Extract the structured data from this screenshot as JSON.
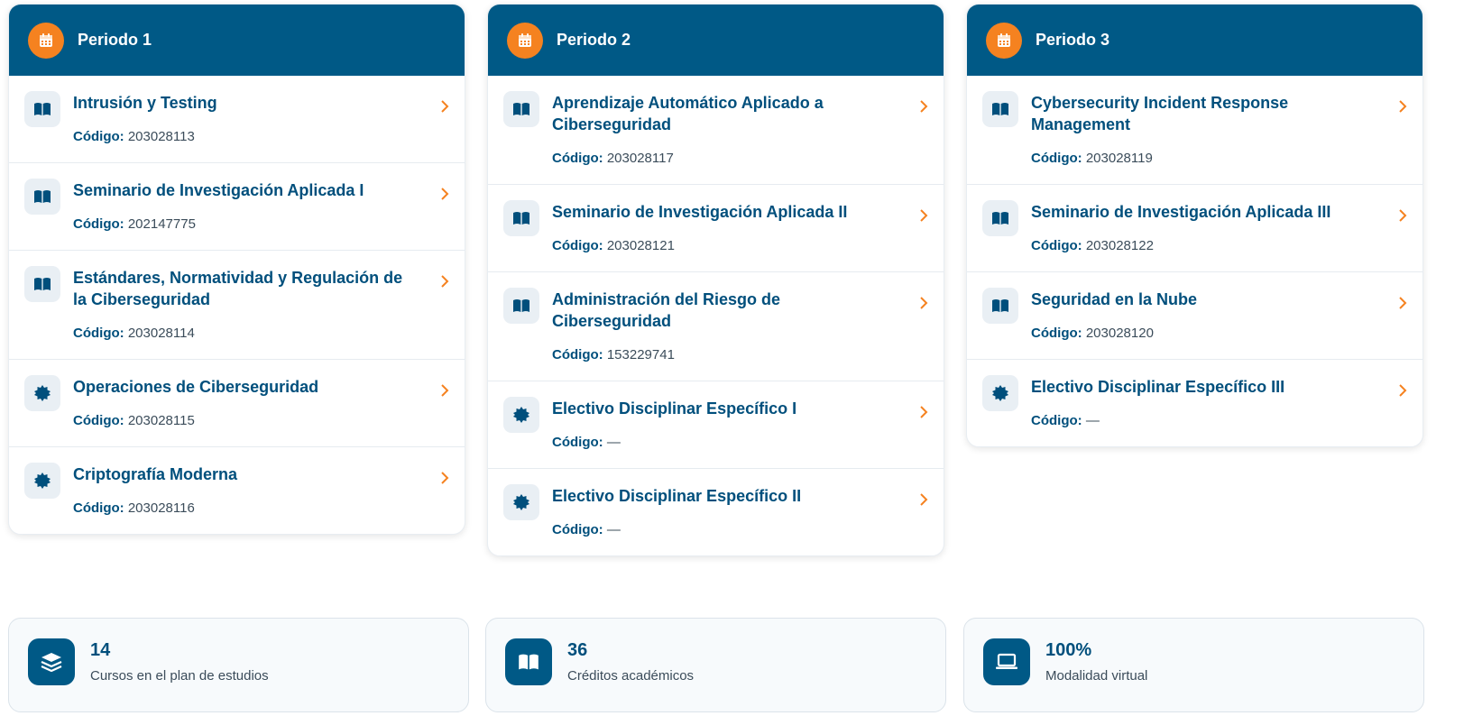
{
  "code_label": "Código:",
  "periods": [
    {
      "title": "Periodo 1",
      "courses": [
        {
          "name": "Intrusión y Testing",
          "code": "203028113",
          "icon": "book-icon"
        },
        {
          "name": "Seminario de Investigación Aplicada I",
          "code": "202147775",
          "icon": "book-icon"
        },
        {
          "name": "Estándares, Normatividad y Regulación de la Ciberseguridad",
          "code": "203028114",
          "icon": "book-icon"
        },
        {
          "name": "Operaciones de Ciberseguridad",
          "code": "203028115",
          "icon": "badge-icon"
        },
        {
          "name": "Criptografía Moderna",
          "code": "203028116",
          "icon": "badge-icon"
        }
      ]
    },
    {
      "title": "Periodo 2",
      "courses": [
        {
          "name": "Aprendizaje Automático Aplicado a Ciberseguridad",
          "code": "203028117",
          "icon": "book-icon"
        },
        {
          "name": "Seminario de Investigación Aplicada II",
          "code": "203028121",
          "icon": "book-icon"
        },
        {
          "name": "Administración del Riesgo de Ciberseguridad",
          "code": "153229741",
          "icon": "book-icon"
        },
        {
          "name": "Electivo Disciplinar Específico I",
          "code": "—",
          "icon": "badge-icon"
        },
        {
          "name": "Electivo Disciplinar Específico II",
          "code": "—",
          "icon": "badge-icon"
        }
      ]
    },
    {
      "title": "Periodo 3",
      "courses": [
        {
          "name": "Cybersecurity Incident Response Management",
          "code": "203028119",
          "icon": "book-icon"
        },
        {
          "name": "Seminario de Investigación Aplicada III",
          "code": "203028122",
          "icon": "book-icon"
        },
        {
          "name": "Seguridad en la Nube",
          "code": "203028120",
          "icon": "book-icon"
        },
        {
          "name": "Electivo Disciplinar Específico III",
          "code": "—",
          "icon": "badge-icon"
        }
      ]
    }
  ],
  "stats": [
    {
      "value": "14",
      "label": "Cursos en el plan de estudios",
      "icon": "layers-icon"
    },
    {
      "value": "36",
      "label": "Créditos académicos",
      "icon": "book-icon"
    },
    {
      "value": "100%",
      "label": "Modalidad virtual",
      "icon": "laptop-icon"
    }
  ],
  "colors": {
    "header": "#005986",
    "accent": "#f58220",
    "text": "#004f7c"
  }
}
